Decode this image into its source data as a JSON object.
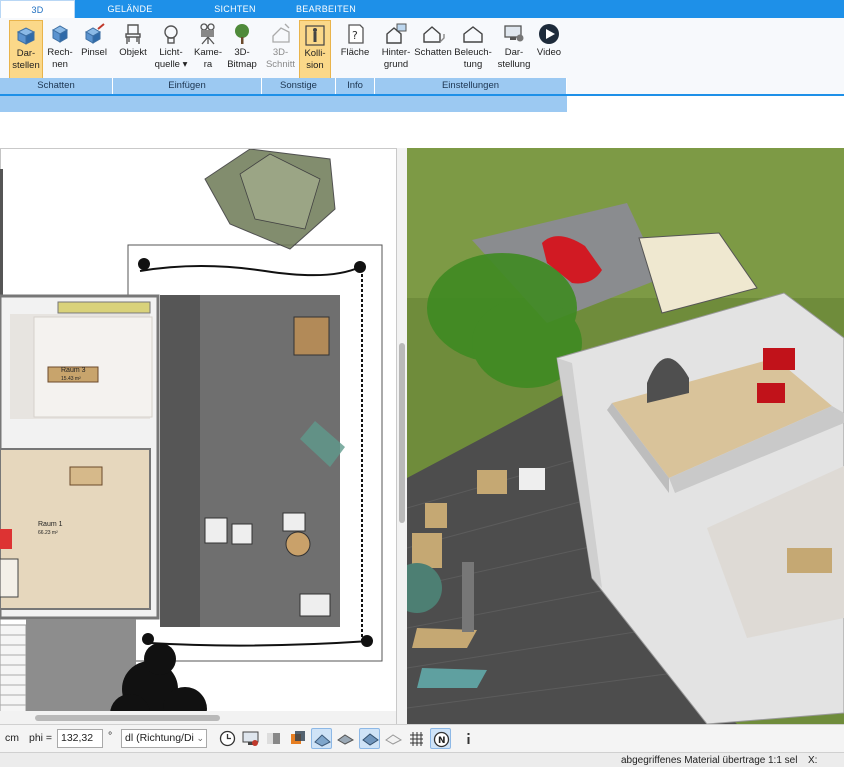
{
  "tabs": [
    {
      "label": "3D",
      "active": true
    },
    {
      "label": "GELÄNDE"
    },
    {
      "label": "SICHTEN"
    },
    {
      "label": "BEARBEITEN"
    }
  ],
  "ribbon": {
    "buttons": [
      {
        "label": "Dar-\nstellen",
        "icon": "house-cube-icon",
        "selected": true
      },
      {
        "label": "Rech-\nnen",
        "icon": "cube-render-icon"
      },
      {
        "label": "Pinsel",
        "icon": "cube-brush-icon"
      },
      {
        "label": "Objekt",
        "icon": "chair-icon"
      },
      {
        "label": "Licht-\nquelle ▾",
        "icon": "lightbulb-icon"
      },
      {
        "label": "Kame-\nra",
        "icon": "camera-icon"
      },
      {
        "label": "3D-\nBitmap",
        "icon": "tree-icon"
      },
      {
        "label": "3D-\nSchnitt",
        "icon": "section-cut-icon",
        "disabled": true
      },
      {
        "label": "Kolli-\nsion",
        "icon": "person-collision-icon",
        "selected": true
      },
      {
        "label": "Fläche",
        "icon": "area-info-icon"
      },
      {
        "label": "Hinter-\ngrund",
        "icon": "house-background-icon"
      },
      {
        "label": "Schatten",
        "icon": "house-shadow-icon"
      },
      {
        "label": "Beleuch-\ntung",
        "icon": "house-lighting-icon"
      },
      {
        "label": "Dar-\nstellung",
        "icon": "monitor-settings-icon"
      },
      {
        "label": "Video",
        "icon": "play-icon"
      }
    ],
    "groups": [
      "Schatten",
      "Einfügen",
      "Sonstige",
      "Info",
      "Einstellungen"
    ]
  },
  "plan": {
    "room1_name": "Raum 1",
    "room1_area": "66.23 m²",
    "room3_name": "Raum 3",
    "room3_area": "15.43 m²"
  },
  "bottombar": {
    "unit": "cm",
    "phi_label": "phi =",
    "phi_value": "132,32",
    "degree": "°",
    "direction_value": "dl (Richtung/Di"
  },
  "status": {
    "message": "abgegriffenes Material übertrage",
    "scale": "1:1 sel",
    "x_label": "X:"
  },
  "colors": {
    "accent": "#1e90e8",
    "selected": "#fbd889",
    "group_bar": "#9cc9f2"
  }
}
